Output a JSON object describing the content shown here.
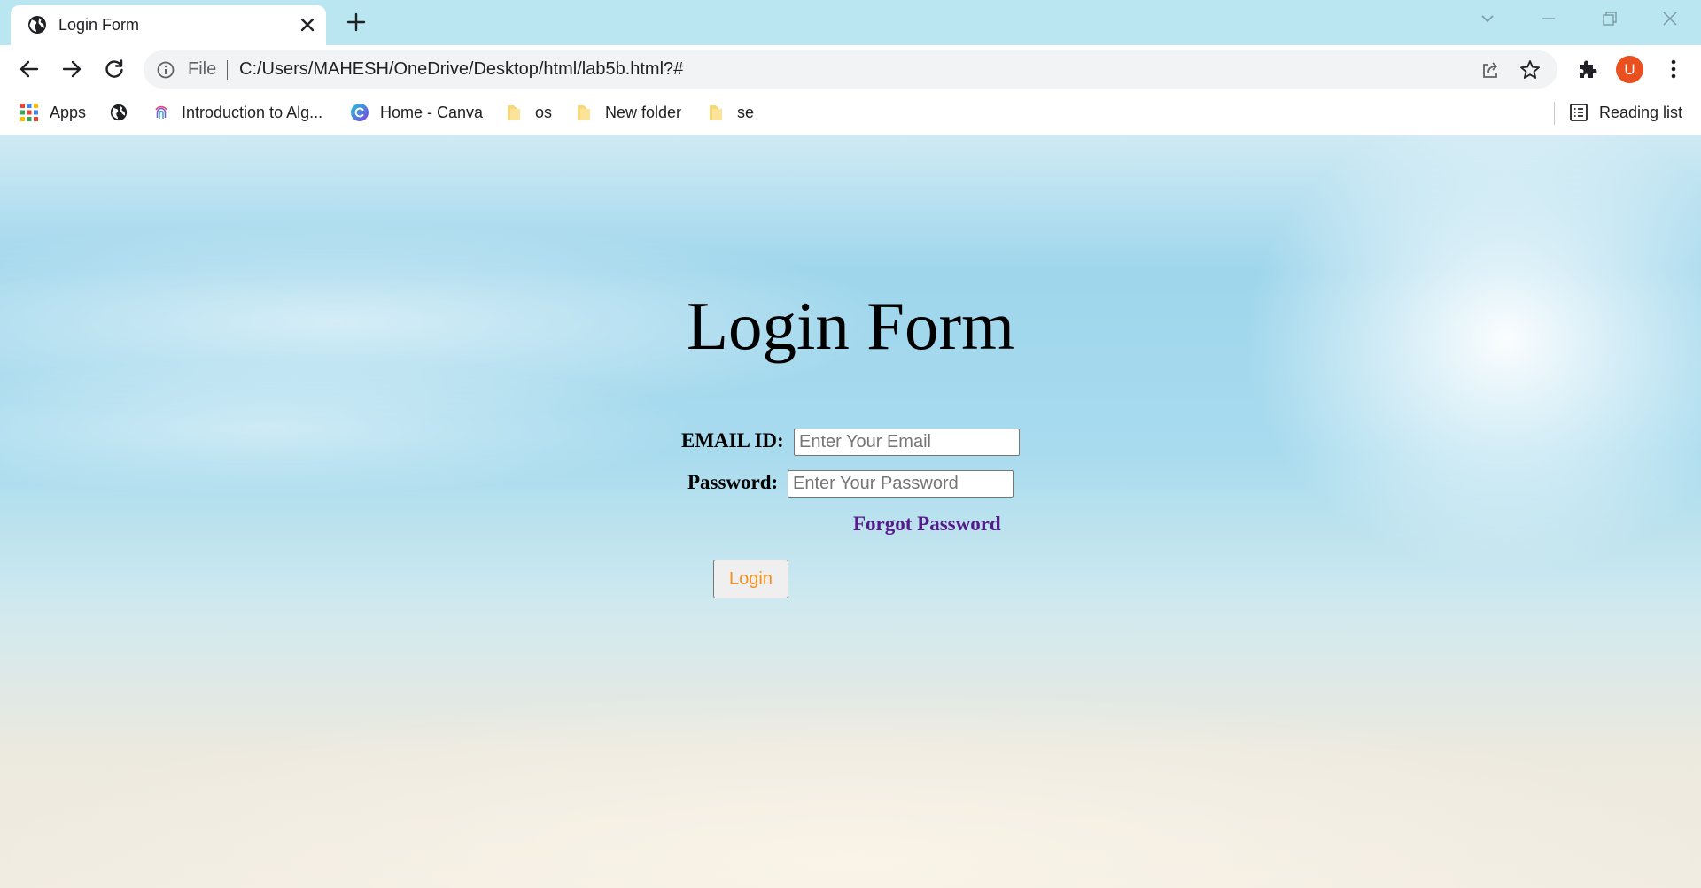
{
  "browser": {
    "tab": {
      "title": "Login Form",
      "favicon": "globe-icon"
    },
    "address_bar": {
      "scheme": "File",
      "url": "C:/Users/MAHESH/OneDrive/Desktop/html/lab5b.html?#"
    },
    "profile_initial": "U",
    "bookmarks": [
      {
        "label": "Apps",
        "icon": "apps-grid-icon"
      },
      {
        "label": "",
        "icon": "globe-icon"
      },
      {
        "label": "Introduction to Alg...",
        "icon": "fingerprint-icon"
      },
      {
        "label": "Home - Canva",
        "icon": "canva-icon"
      },
      {
        "label": "os",
        "icon": "folder-icon"
      },
      {
        "label": "New folder",
        "icon": "folder-icon"
      },
      {
        "label": "se",
        "icon": "folder-icon"
      }
    ],
    "reading_list": "Reading list",
    "colors": {
      "tab_strip": "#b9e6f0",
      "avatar": "#e8501f",
      "folder": "#f8d775"
    }
  },
  "page": {
    "title": "Login Form",
    "form": {
      "email_label": "EMAIL ID:",
      "email_placeholder": "Enter Your Email",
      "password_label": "Password:",
      "password_placeholder": "Enter Your Password",
      "forgot_link": "Forgot Password",
      "login_button": "Login"
    },
    "colors": {
      "link": "#551a8b",
      "button_text": "#f5901f"
    }
  }
}
